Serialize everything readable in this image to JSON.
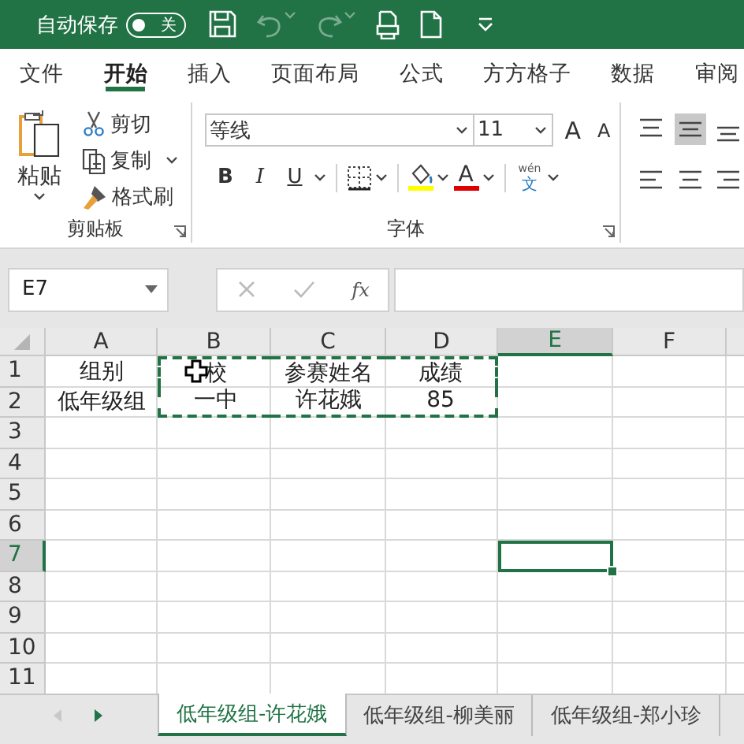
{
  "title_bar": {
    "autosave_label": "自动保存",
    "autosave_on": false,
    "autosave_state": "关"
  },
  "menu_tabs": [
    {
      "label": "文件",
      "selected": false
    },
    {
      "label": "开始",
      "selected": true
    },
    {
      "label": "插入",
      "selected": false
    },
    {
      "label": "页面布局",
      "selected": false
    },
    {
      "label": "公式",
      "selected": false
    },
    {
      "label": "方方格子",
      "selected": false
    },
    {
      "label": "数据",
      "selected": false
    },
    {
      "label": "审阅",
      "selected": false
    }
  ],
  "ribbon": {
    "clipboard": {
      "paste": "粘贴",
      "cut": "剪切",
      "copy": "复制",
      "format_painter": "格式刷",
      "group_label": "剪贴板"
    },
    "font": {
      "font_name": "等线",
      "font_size": "11",
      "grow": "A",
      "shrink": "A",
      "bold": "B",
      "italic": "I",
      "underline": "U",
      "font_color": "A",
      "phonetic_top": "wén",
      "phonetic_bottom": "文",
      "group_label": "字体"
    }
  },
  "formula_bar": {
    "name_box": "E7",
    "function": "fx"
  },
  "grid": {
    "columns": [
      {
        "label": "A",
        "selected": false
      },
      {
        "label": "B",
        "selected": false
      },
      {
        "label": "C",
        "selected": false
      },
      {
        "label": "D",
        "selected": false
      },
      {
        "label": "E",
        "selected": true
      },
      {
        "label": "F",
        "selected": false
      }
    ],
    "rows": [
      {
        "label": "1",
        "selected": false,
        "cells": [
          {
            "text": "组别",
            "copied": false
          },
          {
            "text": "校",
            "copied": true,
            "cursor": true
          },
          {
            "text": "参赛姓名",
            "copied": true
          },
          {
            "text": "成绩",
            "copied": true
          }
        ]
      },
      {
        "label": "2",
        "selected": false,
        "cells": [
          {
            "text": "低年级组",
            "copied": false
          },
          {
            "text": "一中",
            "copied": true
          },
          {
            "text": "许花娥",
            "copied": true
          },
          {
            "text": "85",
            "copied": true
          }
        ]
      },
      {
        "label": "3",
        "selected": false,
        "cells": []
      },
      {
        "label": "4",
        "selected": false,
        "cells": []
      },
      {
        "label": "5",
        "selected": false,
        "cells": []
      },
      {
        "label": "6",
        "selected": false,
        "cells": []
      },
      {
        "label": "7",
        "selected": true,
        "cells": []
      },
      {
        "label": "8",
        "selected": false,
        "cells": []
      },
      {
        "label": "9",
        "selected": false,
        "cells": []
      },
      {
        "label": "10",
        "selected": false,
        "cells": []
      },
      {
        "label": "11",
        "selected": false,
        "cells": []
      }
    ]
  },
  "sheet_tabs": [
    {
      "label": "低年级组-许花娥",
      "selected": true
    },
    {
      "label": "低年级组-柳美丽",
      "selected": false
    },
    {
      "label": "低年级组-郑小珍",
      "selected": false
    }
  ]
}
